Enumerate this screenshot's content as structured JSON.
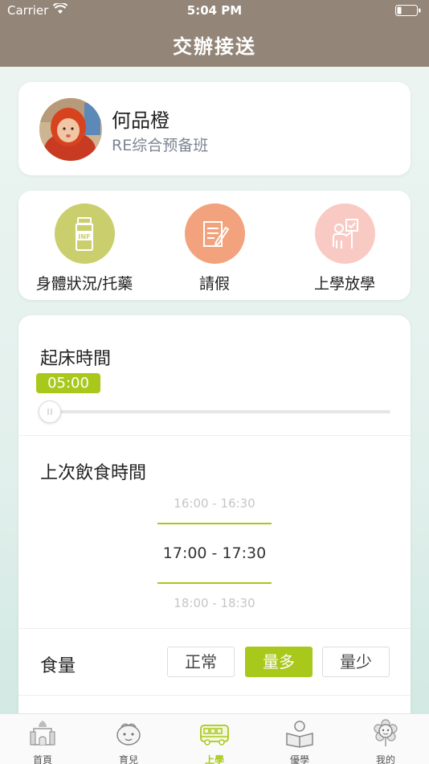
{
  "status_bar": {
    "carrier": "Carrier",
    "time": "5:04 PM"
  },
  "nav": {
    "title": "交辦接送"
  },
  "profile": {
    "name": "何品橙",
    "class_name": "RE综合预备班"
  },
  "actions": [
    {
      "label": "身體狀況/托藥",
      "icon": "medicine-bottle-icon",
      "color": "#cbce6c"
    },
    {
      "label": "請假",
      "icon": "leave-note-icon",
      "color": "#f2a27c"
    },
    {
      "label": "上學放學",
      "icon": "pickup-person-icon",
      "color": "#f9cac3"
    }
  ],
  "wake_time": {
    "title": "起床時間",
    "value": "05:00",
    "progress": 0
  },
  "last_meal": {
    "title": "上次飲食時間",
    "options": [
      "16:00 - 16:30",
      "17:00 - 17:30",
      "18:00 - 18:30"
    ],
    "selected_index": 1
  },
  "food_amount": {
    "title": "食量",
    "options": [
      "正常",
      "量多",
      "量少"
    ],
    "selected_index": 1
  },
  "tabs": [
    {
      "label": "首頁",
      "icon": "castle-icon"
    },
    {
      "label": "育兒",
      "icon": "baby-face-icon"
    },
    {
      "label": "上學",
      "icon": "school-bus-icon"
    },
    {
      "label": "優學",
      "icon": "reading-kid-icon"
    },
    {
      "label": "我的",
      "icon": "flower-face-icon"
    }
  ],
  "active_tab_index": 2,
  "colors": {
    "accent": "#a9c81c",
    "header": "#938678",
    "background": "#e2f0ec"
  }
}
